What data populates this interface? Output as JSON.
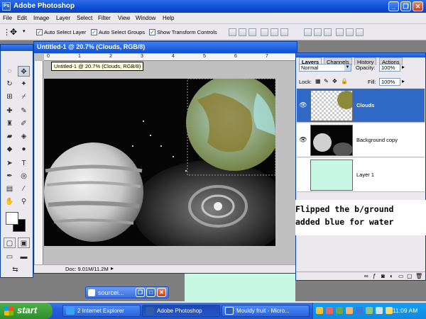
{
  "window": {
    "title": "Adobe Photoshop"
  },
  "menu": [
    "File",
    "Edit",
    "Image",
    "Layer",
    "Select",
    "Filter",
    "View",
    "Window",
    "Help"
  ],
  "options": {
    "auto_select_layer": "Auto Select Layer",
    "auto_select_groups": "Auto Select Groups",
    "show_transform_controls": "Show Transform Controls"
  },
  "document": {
    "title": "Untitled-1 @ 20.7% (Clouds, RGB/8)",
    "tooltip": "Untitled-1 @ 20.7% (Clouds, RGB/8)",
    "status": "Doc: 9.01M/11.2M",
    "ruler_marks": [
      "0",
      "1",
      "2",
      "3",
      "4",
      "5",
      "6",
      "7"
    ]
  },
  "layers_panel": {
    "tabs": [
      "Layers",
      "Channels",
      "History",
      "Actions"
    ],
    "blend_mode": "Normal",
    "opacity_label": "Opacity:",
    "opacity": "100%",
    "lock_label": "Lock:",
    "fill_label": "Fill:",
    "fill": "100%",
    "layers": [
      {
        "name": "Clouds",
        "selected": true,
        "visible": true
      },
      {
        "name": "Background copy",
        "selected": false,
        "visible": true
      },
      {
        "name": "Layer 1",
        "selected": false,
        "visible": false
      }
    ]
  },
  "note": "Flipped the b/ground\nadded blue for water",
  "minimized_window": {
    "label": "sourcei..."
  },
  "taskbar": {
    "start": "start",
    "tasks": [
      {
        "label": "2 Internet Explorer"
      },
      {
        "label": "Adobe Photoshop"
      },
      {
        "label": "Mouldy fruit - Micro..."
      }
    ],
    "clock": "11:09 AM"
  },
  "colors": {
    "taskbar_blue": "#245edb",
    "selection_blue": "#3169c6",
    "layer1_fill": "#c8f7e4"
  }
}
